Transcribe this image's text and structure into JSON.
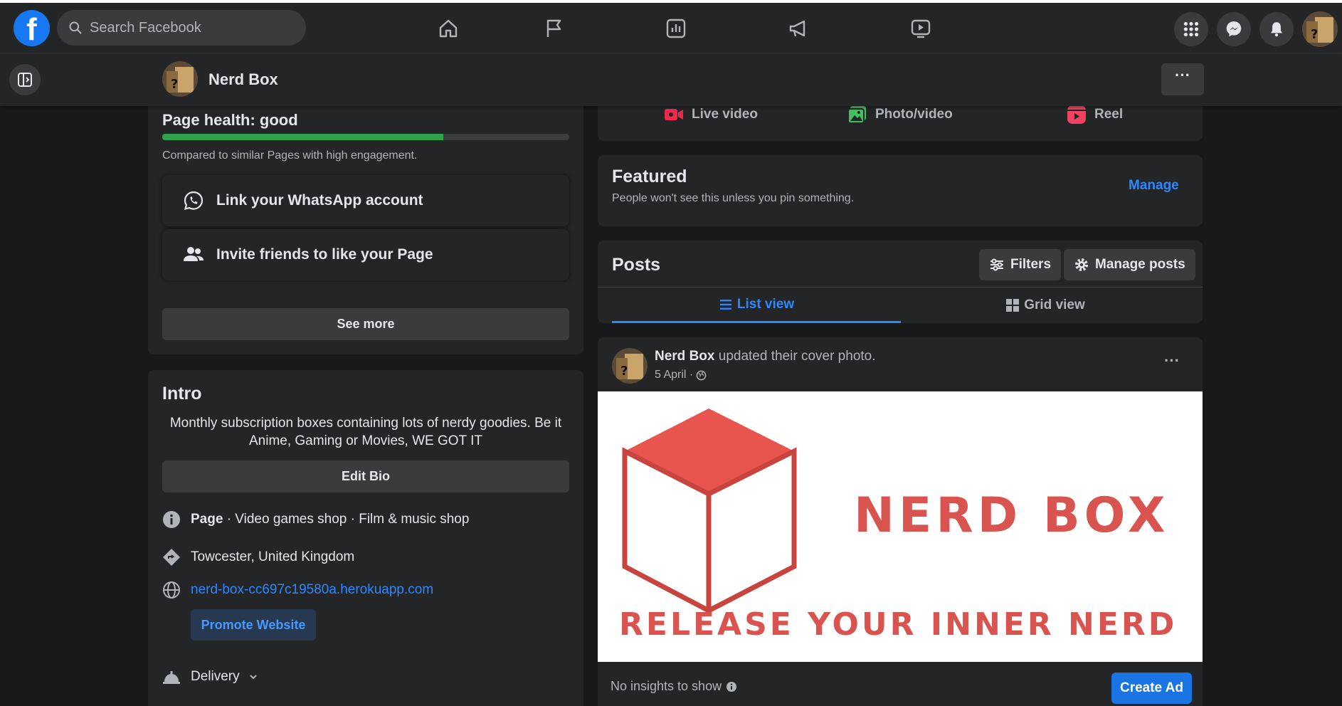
{
  "colors": {
    "background": "#18191a",
    "surface": "#242526",
    "accent": "#2d88ff",
    "health_green": "#31a24c",
    "brand_red": "#d9534f"
  },
  "topbar": {
    "logo_letter": "f",
    "search_placeholder": "Search Facebook",
    "nav_icons": [
      "home-icon",
      "flag-icon",
      "insights-icon",
      "megaphone-icon",
      "watch-icon"
    ],
    "right_icons": [
      "menu-grid-icon",
      "messenger-icon",
      "notifications-icon",
      "profile-avatar"
    ]
  },
  "page_header": {
    "name": "Nerd Box",
    "more_label": "···"
  },
  "health": {
    "title": "Page health: good",
    "level": 0.69,
    "subtitle": "Compared to similar Pages with high engagement.",
    "actions": [
      {
        "label": "Link your WhatsApp account",
        "icon": "whatsapp-icon"
      },
      {
        "label": "Invite friends to like your Page",
        "icon": "friends-icon"
      }
    ],
    "see_more": "See more"
  },
  "intro": {
    "title": "Intro",
    "bio": "Monthly subscription boxes containing lots of nerdy goodies. Be it Anime, Gaming or Movies, WE GOT IT",
    "edit_bio": "Edit Bio",
    "category_lead": "Page",
    "category_rest": " · Video games shop · Film & music shop",
    "location": "Towcester, United Kingdom",
    "website": "nerd-box-cc697c19580a.herokuapp.com",
    "promote": "Promote Website",
    "delivery": "Delivery"
  },
  "composer": {
    "items": [
      {
        "label": "Live video",
        "icon": "live-video-icon"
      },
      {
        "label": "Photo/video",
        "icon": "photo-video-icon"
      },
      {
        "label": "Reel",
        "icon": "reel-icon"
      }
    ]
  },
  "featured": {
    "title": "Featured",
    "subtitle": "People won't see this unless you pin something.",
    "manage": "Manage"
  },
  "posts": {
    "title": "Posts",
    "filters": "Filters",
    "manage_posts": "Manage posts",
    "tabs": [
      "List view",
      "Grid view"
    ],
    "active_tab": "List view"
  },
  "post": {
    "author": "Nerd Box",
    "action": " updated their cover photo.",
    "date": "5 April ·",
    "more": "···",
    "cover_title": "NERD BOX",
    "cover_tagline": "RELEASE YOUR INNER NERD",
    "insights": "No insights to show",
    "create_ad": "Create Ad"
  }
}
